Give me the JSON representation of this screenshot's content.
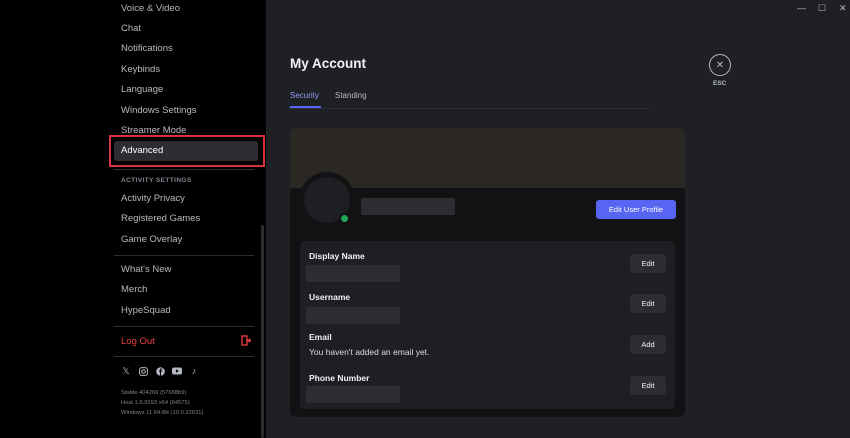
{
  "window": {
    "minimize_icon": "minimize-icon",
    "maximize_icon": "maximize-icon",
    "close_icon": "close-icon"
  },
  "sidebar": {
    "items_top": [
      "Voice & Video",
      "Chat",
      "Notifications",
      "Keybinds",
      "Language",
      "Windows Settings",
      "Streamer Mode"
    ],
    "selected": "Advanced",
    "activity_header": "ACTIVITY SETTINGS",
    "activity_items": [
      "Activity Privacy",
      "Registered Games",
      "Game Overlay"
    ],
    "misc_items": [
      "What's New",
      "Merch",
      "HypeSquad"
    ],
    "logout": "Log Out",
    "version_lines": [
      "Stable 404269 (57688b9)",
      "Host 1.0.9193 x64 (64575)",
      "Windows 11 64-Bit (10.0.22631)"
    ]
  },
  "main": {
    "title": "My Account",
    "tabs": [
      "Security",
      "Standing"
    ],
    "esc_label": "ESC",
    "edit_profile_label": "Edit User Profile",
    "fields": [
      {
        "label": "Display Name",
        "value": "",
        "button": "Edit"
      },
      {
        "label": "Username",
        "value": "",
        "button": "Edit"
      },
      {
        "label": "Email",
        "value": "You haven't added an email yet.",
        "button": "Add"
      },
      {
        "label": "Phone Number",
        "value": "",
        "button": "Edit"
      }
    ]
  },
  "colors": {
    "accent": "#5865f2",
    "highlight_box": "#d9323a",
    "logout": "#f23f43",
    "status_online": "#23a55a"
  }
}
